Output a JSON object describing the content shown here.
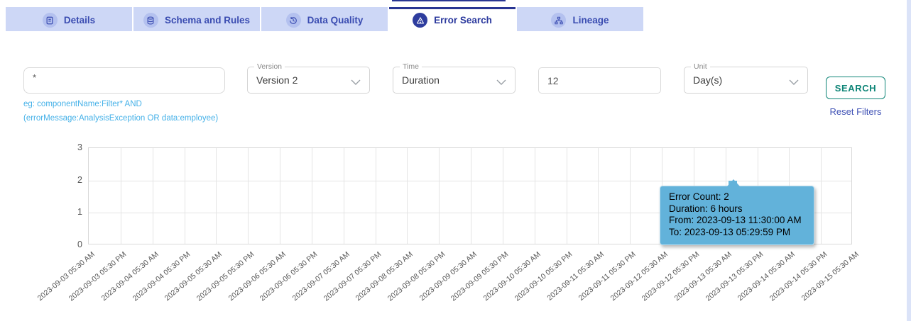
{
  "tabs": [
    {
      "label": "Details",
      "icon": "document-icon",
      "active": false
    },
    {
      "label": "Schema and Rules",
      "icon": "database-icon",
      "active": false
    },
    {
      "label": "Data Quality",
      "icon": "history-icon",
      "active": false
    },
    {
      "label": "Error Search",
      "icon": "alert-triangle-icon",
      "active": true
    },
    {
      "label": "Lineage",
      "icon": "lineage-icon",
      "active": false
    }
  ],
  "filters": {
    "query": {
      "value": "*",
      "helper_line1": "eg: componentName:Filter* AND",
      "helper_line2": "(errorMessage:AnalysisException OR data:employee)"
    },
    "version": {
      "label": "Version",
      "value": "Version 2"
    },
    "time": {
      "label": "Time",
      "value": "Duration"
    },
    "duration": {
      "value": "12"
    },
    "unit": {
      "label": "Unit",
      "value": "Day(s)"
    },
    "search_label": "SEARCH",
    "reset_label": "Reset Filters"
  },
  "colors": {
    "tab_bg": "#cdd7f6",
    "tab_text": "#3a4cb1",
    "active_tab_border": "#283593",
    "helper_text": "#45b1e8",
    "search_button": "#0e8577",
    "reset_link": "#3f51b5",
    "bar": "#67b7dc",
    "tooltip_bg": "#62b2da",
    "gridline": "#e4e4e4"
  },
  "chart_data": {
    "type": "bar",
    "title": "",
    "xlabel": "",
    "ylabel": "",
    "y_ticks": [
      0,
      1,
      2,
      3
    ],
    "ylim": [
      0,
      3
    ],
    "grid": true,
    "bucket_hours": 6,
    "x_labels": [
      "2023-09-03 05:30 AM",
      "2023-09-03 05:30 PM",
      "2023-09-04 05:30 AM",
      "2023-09-04 05:30 PM",
      "2023-09-05 05:30 AM",
      "2023-09-05 05:30 PM",
      "2023-09-06 05:30 AM",
      "2023-09-06 05:30 PM",
      "2023-09-07 05:30 AM",
      "2023-09-07 05:30 PM",
      "2023-09-08 05:30 AM",
      "2023-09-08 05:30 PM",
      "2023-09-09 05:30 AM",
      "2023-09-09 05:30 PM",
      "2023-09-10 05:30 AM",
      "2023-09-10 05:30 PM",
      "2023-09-11 05:30 AM",
      "2023-09-11 05:30 PM",
      "2023-09-12 05:30 AM",
      "2023-09-12 05:30 PM",
      "2023-09-13 05:30 AM",
      "2023-09-13 05:30 PM",
      "2023-09-14 05:30 AM",
      "2023-09-14 05:30 PM",
      "2023-09-15 05:30 AM"
    ],
    "bars": [
      {
        "count": 2,
        "from": "2023-09-13 11:30:00 AM",
        "to": "2023-09-13 05:29:59 PM",
        "x_fraction": 0.843
      }
    ]
  },
  "tooltip": {
    "lines": [
      "Error Count: 2",
      "Duration: 6 hours",
      "From: 2023-09-13 11:30:00 AM",
      "To: 2023-09-13 05:29:59 PM"
    ]
  }
}
